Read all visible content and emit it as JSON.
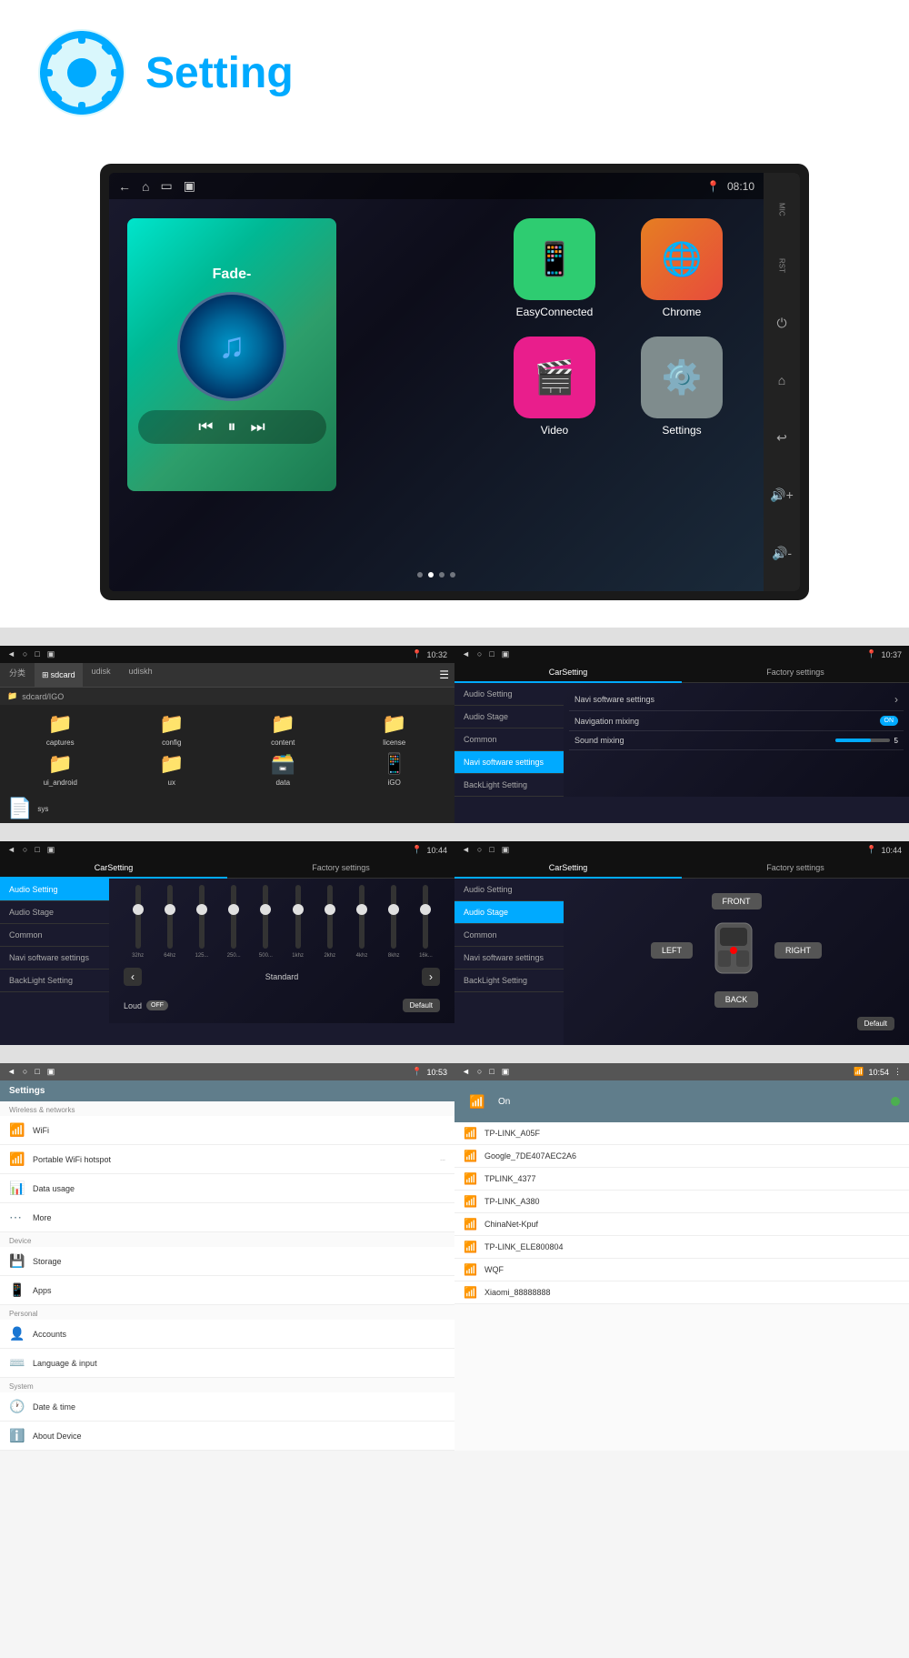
{
  "header": {
    "title": "Setting"
  },
  "device": {
    "time": "08:10",
    "location_icon": "📍",
    "mic_label": "MIC",
    "rst_label": "RST",
    "music_title": "Fade-",
    "apps": [
      {
        "label": "EasyConnected",
        "color": "app-green",
        "icon": "📱"
      },
      {
        "label": "Chrome",
        "color": "app-orange",
        "icon": "🌐"
      },
      {
        "label": "Video",
        "color": "app-pink",
        "icon": "🎬"
      },
      {
        "label": "Settings",
        "color": "app-gray",
        "icon": "⚙️"
      }
    ]
  },
  "file_manager": {
    "time": "10:32",
    "tabs": [
      "分类",
      "sdcard",
      "udisk",
      "udiskh"
    ],
    "path": "sdcard/IGO",
    "items": [
      "captures",
      "config",
      "content",
      "license",
      "ui_android",
      "ux",
      "data",
      "iGO",
      "sys"
    ]
  },
  "car_settings_navi": {
    "time": "10:37",
    "tabs": [
      "CarSetting",
      "Factory settings"
    ],
    "sidebar_items": [
      "Audio Setting",
      "Audio Stage",
      "Common",
      "Navi software settings",
      "BackLight Setting"
    ],
    "active_item": "Navi software settings",
    "settings": [
      {
        "label": "Navi software settings",
        "value": ">"
      },
      {
        "label": "Navigation mixing",
        "value": "ON"
      },
      {
        "label": "Sound mixing",
        "value": "5"
      }
    ]
  },
  "car_settings_eq": {
    "time": "10:44",
    "tabs": [
      "CarSetting",
      "Factory settings"
    ],
    "sidebar_items": [
      "Audio Setting",
      "Audio Stage",
      "Common",
      "Navi software settings",
      "BackLight Setting"
    ],
    "active_item": "Audio Setting",
    "eq_labels": [
      "32hz",
      "64hz",
      "125...",
      "250...",
      "500...",
      "1khz",
      "2khz",
      "4khz",
      "8khz",
      "16k..."
    ],
    "eq_positions": [
      50,
      50,
      50,
      50,
      50,
      50,
      50,
      50,
      50,
      50
    ],
    "preset": "Standard",
    "loud_label": "Loud",
    "loud_on": false,
    "default_label": "Default"
  },
  "car_settings_stage": {
    "time": "10:44",
    "tabs": [
      "CarSetting",
      "Factory settings"
    ],
    "sidebar_items": [
      "Audio Setting",
      "Audio Stage",
      "Common",
      "Navi software settings",
      "BackLight Setting"
    ],
    "active_item": "Audio Stage",
    "buttons": [
      "FRONT",
      "LEFT",
      "RIGHT",
      "BACK"
    ],
    "default_label": "Default"
  },
  "android_settings": {
    "time": "10:53",
    "title": "Settings",
    "sections": [
      {
        "name": "Wireless & networks",
        "items": [
          {
            "icon": "📶",
            "label": "WiFi",
            "sub": ""
          },
          {
            "icon": "📶",
            "label": "Portable WiFi hotspot",
            "sub": "..."
          },
          {
            "icon": "📊",
            "label": "Data usage",
            "sub": ""
          },
          {
            "icon": "⋯",
            "label": "More",
            "sub": ""
          }
        ]
      },
      {
        "name": "Device",
        "items": [
          {
            "icon": "💾",
            "label": "Storage",
            "sub": ""
          },
          {
            "icon": "📱",
            "label": "Apps",
            "sub": ""
          }
        ]
      },
      {
        "name": "Personal",
        "items": [
          {
            "icon": "👤",
            "label": "Accounts",
            "sub": ""
          },
          {
            "icon": "⌨️",
            "label": "Language & input",
            "sub": ""
          }
        ]
      },
      {
        "name": "System",
        "items": [
          {
            "icon": "🕐",
            "label": "Date & time",
            "sub": ""
          },
          {
            "icon": "ℹ️",
            "label": "About Device",
            "sub": ""
          }
        ]
      }
    ]
  },
  "wifi_list": {
    "time": "10:54",
    "on_label": "On",
    "networks": [
      "TP-LINK_A05F",
      "Google_7DE407AEC2A6",
      "TPLINK_4377",
      "TP-LINK_A380",
      "ChinaNet-Kpuf",
      "TP-LINK_ELE800804",
      "WQF",
      "Xiaomi_88888888"
    ]
  }
}
